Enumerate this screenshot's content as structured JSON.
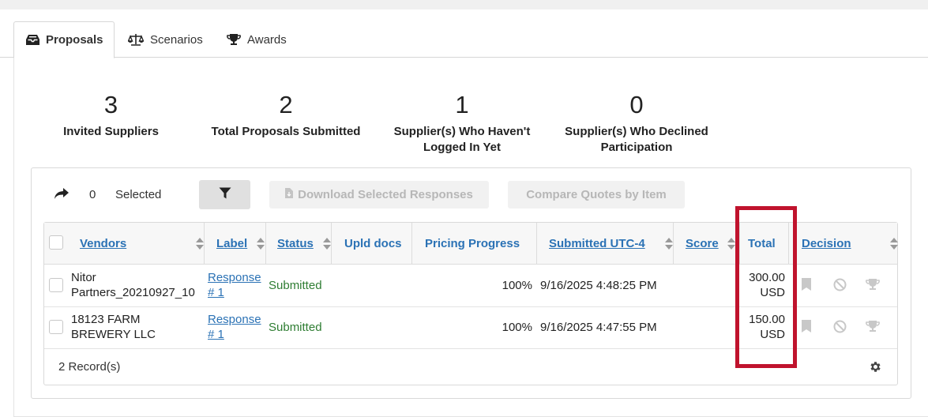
{
  "tabs": [
    {
      "label": "Proposals",
      "icon": "inbox-icon",
      "active": true
    },
    {
      "label": "Scenarios",
      "icon": "balance-scale-icon",
      "active": false
    },
    {
      "label": "Awards",
      "icon": "trophy-icon",
      "active": false
    }
  ],
  "stats": [
    {
      "value": "3",
      "label": "Invited Suppliers"
    },
    {
      "value": "2",
      "label": "Total Proposals Submitted"
    },
    {
      "value": "1",
      "label_line1": "Supplier(s) Who Haven't",
      "label_line2": "Logged In Yet"
    },
    {
      "value": "0",
      "label_line1": "Supplier(s) Who Declined",
      "label_line2": "Participation"
    }
  ],
  "toolbar": {
    "selected_count": "0",
    "selected_label": "Selected",
    "download_label": "Download Selected Responses",
    "compare_label": "Compare Quotes by Item"
  },
  "columns": {
    "vendors": "Vendors",
    "label": "Label",
    "status": "Status",
    "upld": "Upld docs",
    "pricing": "Pricing Progress",
    "submitted": "Submitted UTC-4",
    "score": "Score",
    "total": "Total",
    "decision": "Decision"
  },
  "rows": [
    {
      "vendor_line1": "Nitor",
      "vendor_line2": "Partners_20210927_10",
      "label_line1": "Response",
      "label_line2": "# 1",
      "status": "Submitted",
      "pricing": "100%",
      "submitted": "9/16/2025 4:48:25 PM",
      "total_line1": "300.00",
      "total_line2": "USD"
    },
    {
      "vendor_line1": "18123 FARM",
      "vendor_line2": "BREWERY LLC",
      "label_line1": "Response",
      "label_line2": "# 1",
      "status": "Submitted",
      "pricing": "100%",
      "submitted": "9/16/2025 4:47:55 PM",
      "total_line1": "150.00",
      "total_line2": "USD"
    }
  ],
  "footer": {
    "records": "2 Record(s)"
  },
  "colors": {
    "link": "#2b72b5",
    "status_green": "#2e7d32",
    "highlight": "#c0132d"
  }
}
